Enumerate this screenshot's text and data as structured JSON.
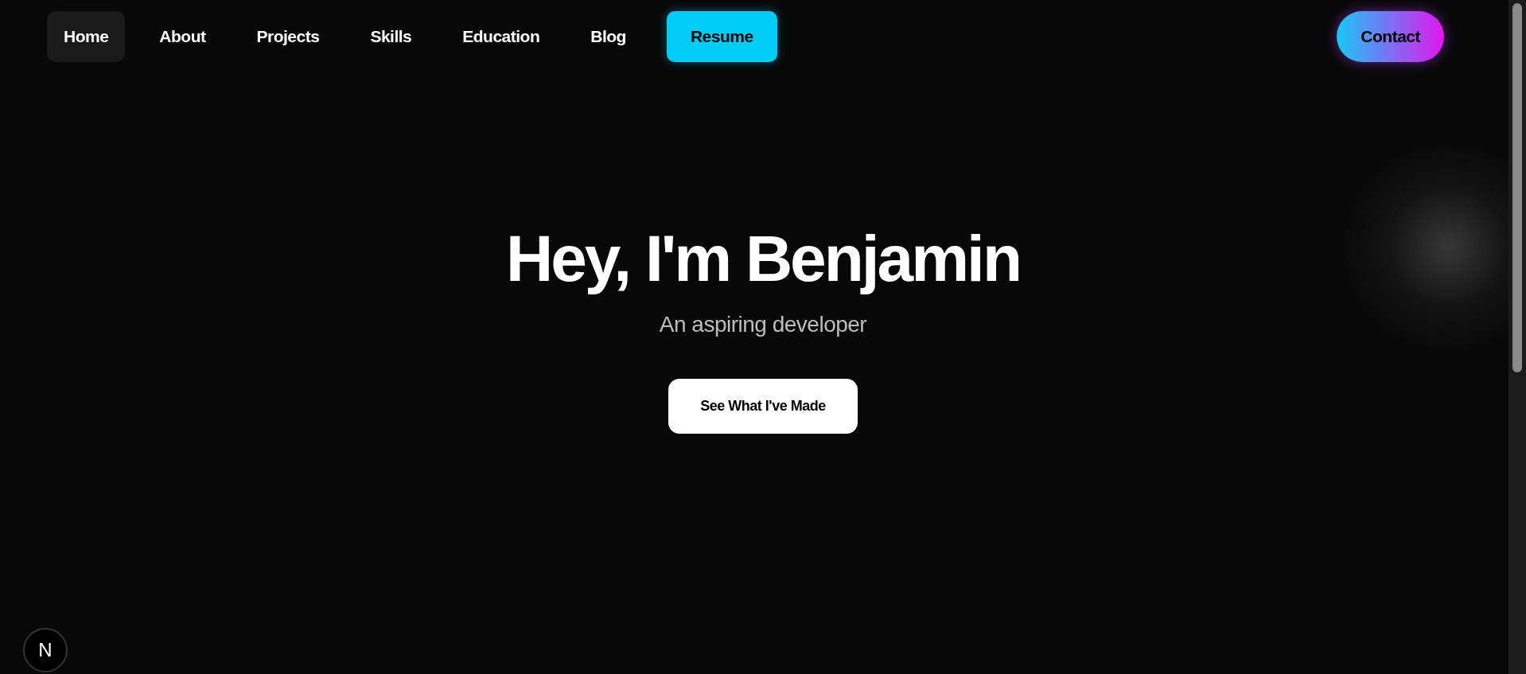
{
  "nav": {
    "links": [
      {
        "label": "Home",
        "selected": true
      },
      {
        "label": "About",
        "selected": false
      },
      {
        "label": "Projects",
        "selected": false
      },
      {
        "label": "Skills",
        "selected": false
      },
      {
        "label": "Education",
        "selected": false
      },
      {
        "label": "Blog",
        "selected": false
      }
    ],
    "resume": {
      "label": "Resume"
    },
    "contact": {
      "label": "Contact"
    }
  },
  "hero": {
    "title": "Hey, I'm Benjamin",
    "subtitle": "An aspiring developer",
    "cta": "See What I've Made"
  },
  "badge": {
    "letter": "N"
  }
}
